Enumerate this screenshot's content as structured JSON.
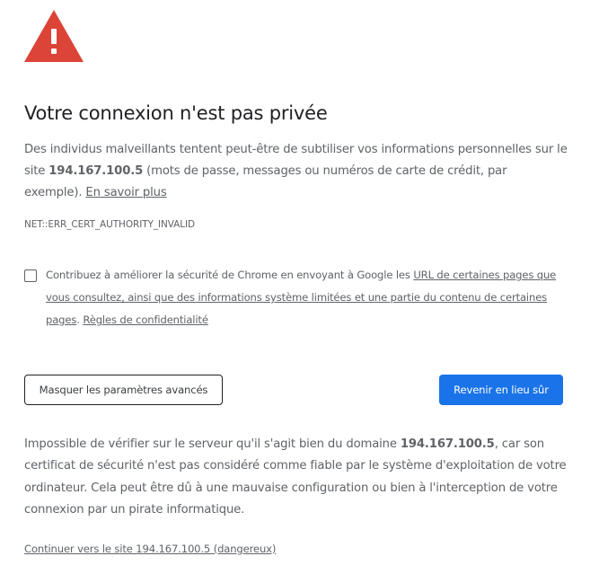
{
  "icon": {
    "name": "warning-triangle-icon",
    "color": "#db4437"
  },
  "title": "Votre connexion n'est pas privée",
  "intro": {
    "text_before_host": "Des individus malveillants tentent peut-être de subtiliser vos informations personnelles sur le site ",
    "host": "194.167.100.5",
    "text_after_host": " (mots de passe, messages ou numéros de carte de crédit, par exemple). ",
    "learn_more": "En savoir plus"
  },
  "error_code": "NET::ERR_CERT_AUTHORITY_INVALID",
  "optin": {
    "checked": false,
    "text_before_link": "Contribuez à améliorer la sécurité de Chrome en envoyant à Google les ",
    "link_text": "URL de certaines pages que vous consultez, ainsi que des informations système limitées et une partie du contenu de certaines pages",
    "text_between": ". ",
    "privacy_link": "Règles de confidentialité"
  },
  "buttons": {
    "advanced": "Masquer les paramètres avancés",
    "back_to_safety": "Revenir en lieu sûr"
  },
  "details": {
    "text_before_host": "Impossible de vérifier sur le serveur qu'il s'agit bien du domaine ",
    "host": "194.167.100.5",
    "text_after_host": ", car son certificat de sécurité n'est pas considéré comme fiable par le système d'exploitation de votre ordinateur. Cela peut être dû à une mauvaise configuration ou bien à l'interception de votre connexion par un pirate informatique."
  },
  "proceed_link": "Continuer vers le site 194.167.100.5 (dangereux)",
  "colors": {
    "primary_button": "#1a73e8",
    "body_text": "#5f6368",
    "title_text": "#202124",
    "warning_red": "#db4437"
  }
}
